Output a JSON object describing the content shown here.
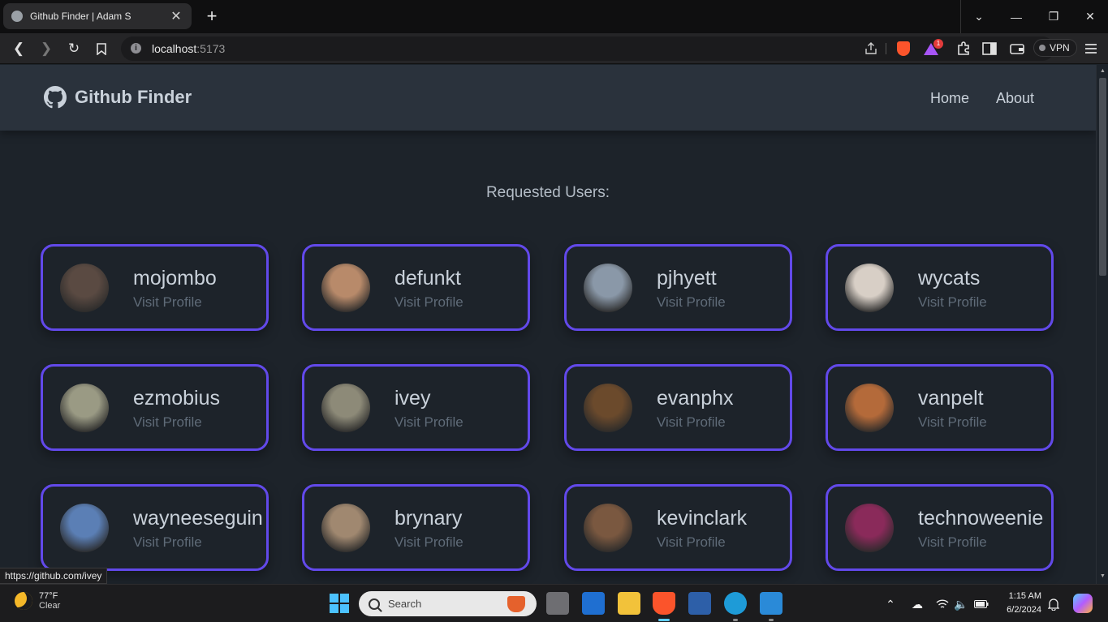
{
  "browser": {
    "tab_title": "Github Finder | Adam S",
    "new_tab_glyph": "+",
    "url_host": "localhost",
    "url_port": ":5173",
    "extension_badge": "1",
    "vpn_label": "VPN",
    "status_url": "https://github.com/ivey"
  },
  "app": {
    "brand": "Github Finder",
    "nav": [
      "Home",
      "About"
    ],
    "heading": "Requested Users:",
    "visit_label": "Visit Profile",
    "users": [
      {
        "login": "mojombo",
        "avatar_color": "#5a4a42"
      },
      {
        "login": "defunkt",
        "avatar_color": "#b88a6a"
      },
      {
        "login": "pjhyett",
        "avatar_color": "#8a98a8"
      },
      {
        "login": "wycats",
        "avatar_color": "#d8cfc6"
      },
      {
        "login": "ezmobius",
        "avatar_color": "#9a9a84"
      },
      {
        "login": "ivey",
        "avatar_color": "#8d8a78"
      },
      {
        "login": "evanphx",
        "avatar_color": "#6b4a2c"
      },
      {
        "login": "vanpelt",
        "avatar_color": "#b46a3a"
      },
      {
        "login": "wayneeseguin",
        "avatar_color": "#5b7fb5"
      },
      {
        "login": "brynary",
        "avatar_color": "#a08870"
      },
      {
        "login": "kevinclark",
        "avatar_color": "#7a5840"
      },
      {
        "login": "technoweenie",
        "avatar_color": "#8a2a5a"
      }
    ]
  },
  "taskbar": {
    "weather_temp": "77°F",
    "weather_desc": "Clear",
    "search_placeholder": "Search",
    "time": "1:15 AM",
    "date": "6/2/2024"
  },
  "colors": {
    "accent": "#6249ea",
    "page_bg": "#1d232a",
    "navbar_bg": "#2a323c"
  }
}
